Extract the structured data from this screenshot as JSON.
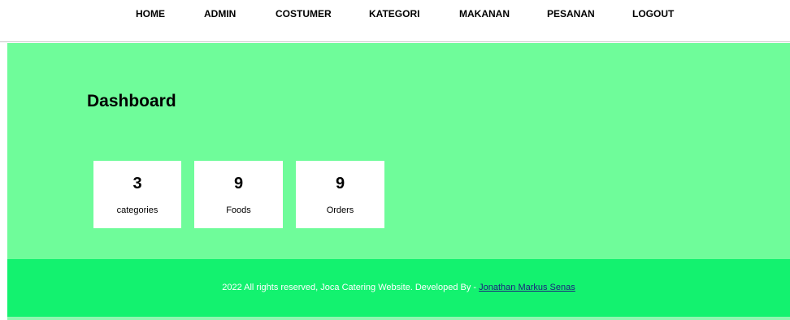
{
  "nav": {
    "items": [
      {
        "label": "HOME"
      },
      {
        "label": "ADMIN"
      },
      {
        "label": "COSTUMER"
      },
      {
        "label": "KATEGORI"
      },
      {
        "label": "MAKANAN"
      },
      {
        "label": "PESANAN"
      },
      {
        "label": "LOGOUT"
      }
    ]
  },
  "main": {
    "title": "Dashboard",
    "cards": [
      {
        "count": "3",
        "label": "categories"
      },
      {
        "count": "9",
        "label": "Foods"
      },
      {
        "count": "9",
        "label": "Orders"
      }
    ]
  },
  "footer": {
    "text": "2022 All rights reserved, Joca Catering Website. Developed By - ",
    "link": "Jonathan Markus Senas"
  },
  "colors": {
    "main_bg": "#6ffc9a",
    "footer_bg": "#13f26f",
    "link": "#1a237e"
  }
}
